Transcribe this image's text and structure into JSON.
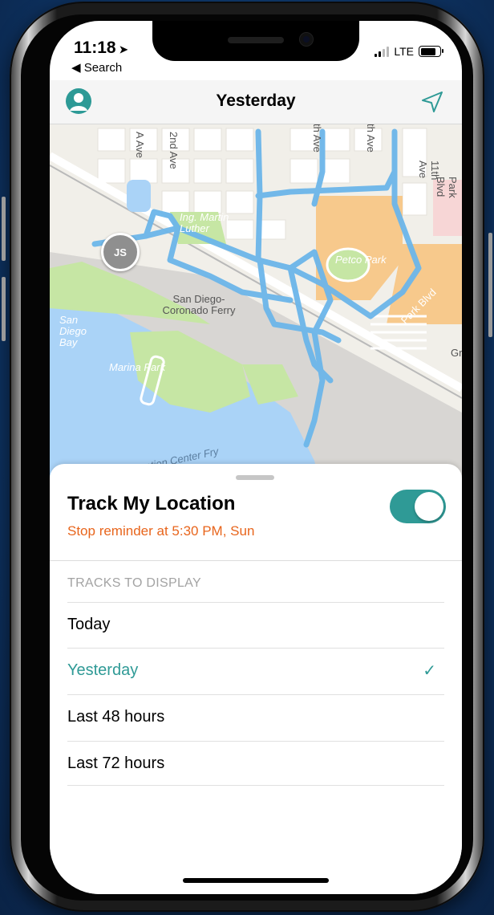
{
  "status_bar": {
    "time": "11:18",
    "back_label": "◀ Search",
    "network": "LTE"
  },
  "navbar": {
    "title": "Yesterday"
  },
  "map": {
    "labels": {
      "ave_a": "A Ave",
      "ave_2nd": "2nd Ave",
      "ave_th1": "th Ave",
      "ave_th2": "th Ave",
      "ave_11th": "11th Ave",
      "park_blvd": "Park Blvd",
      "park_blvd2": "Park Blvd",
      "mlk": "Ing. Martin Luther",
      "petco": "Petco Park",
      "ferry": "San Diego-Coronado Ferry",
      "bay": "San Diego Bay",
      "marina": "Marina Park",
      "center": "ntion Center Fry",
      "gr": "Gr"
    },
    "marker_initials": "JS"
  },
  "sheet": {
    "track_title": "Track My Location",
    "reminder": "Stop reminder at 5:30 PM, Sun",
    "toggle_on": true,
    "section_header": "TRACKS TO DISPLAY",
    "options": [
      {
        "label": "Today",
        "selected": false
      },
      {
        "label": "Yesterday",
        "selected": true
      },
      {
        "label": "Last 48 hours",
        "selected": false
      },
      {
        "label": "Last 72 hours",
        "selected": false
      }
    ],
    "checkmark": "✓"
  },
  "colors": {
    "accent": "#2f9a96",
    "reminder": "#e8651c",
    "track_path": "#6cb6ea",
    "water": "#aad3f7",
    "park": "#c6e6a4",
    "stadium": "#f7c98c"
  },
  "icons": {
    "back": "back-arrow-icon",
    "location_arrow": "location-arrow-icon",
    "profile": "profile-icon",
    "locate": "navigation-arrow-icon",
    "check": "checkmark-icon"
  }
}
